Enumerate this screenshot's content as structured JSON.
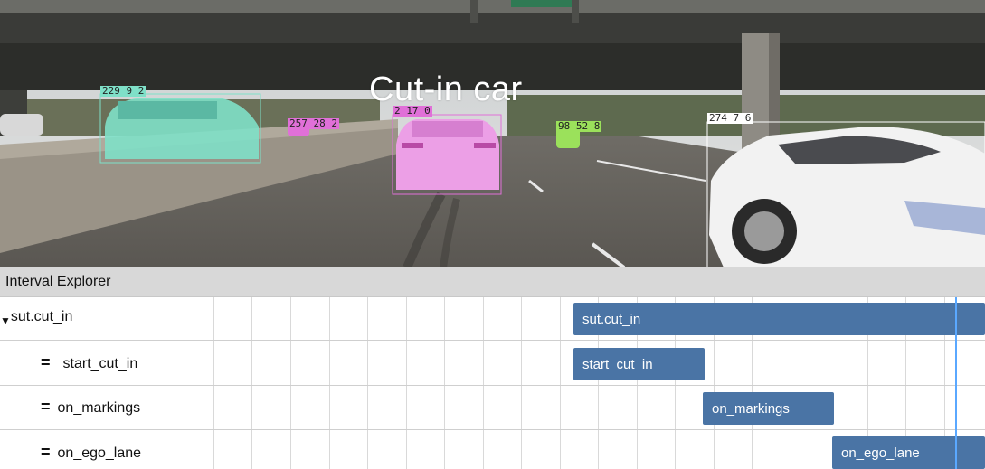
{
  "overlay": {
    "title": "Cut-in car"
  },
  "detections": [
    {
      "label": "229 9 2",
      "color": "#7fe0c8"
    },
    {
      "label": "257 28 2",
      "color": "#e070d8"
    },
    {
      "label": "2 17 0",
      "color": "#e070d8"
    },
    {
      "label": "98 52 8",
      "color": "#9be15b"
    },
    {
      "label": "274 7 6",
      "color": "#ffffff"
    }
  ],
  "explorer": {
    "title": "Interval Explorer",
    "rows": [
      {
        "label": "sut.cut_in",
        "prefix": "▼",
        "bar_label": "sut.cut_in"
      },
      {
        "label": "start_cut_in",
        "prefix": "=",
        "bar_label": "start_cut_in"
      },
      {
        "label": "on_markings",
        "prefix": "=",
        "bar_label": "on_markings"
      },
      {
        "label": "on_ego_lane",
        "prefix": "=",
        "bar_label": "on_ego_lane"
      }
    ],
    "bar_color": "#4a74a5",
    "cursor_color": "#5aa8ff"
  }
}
